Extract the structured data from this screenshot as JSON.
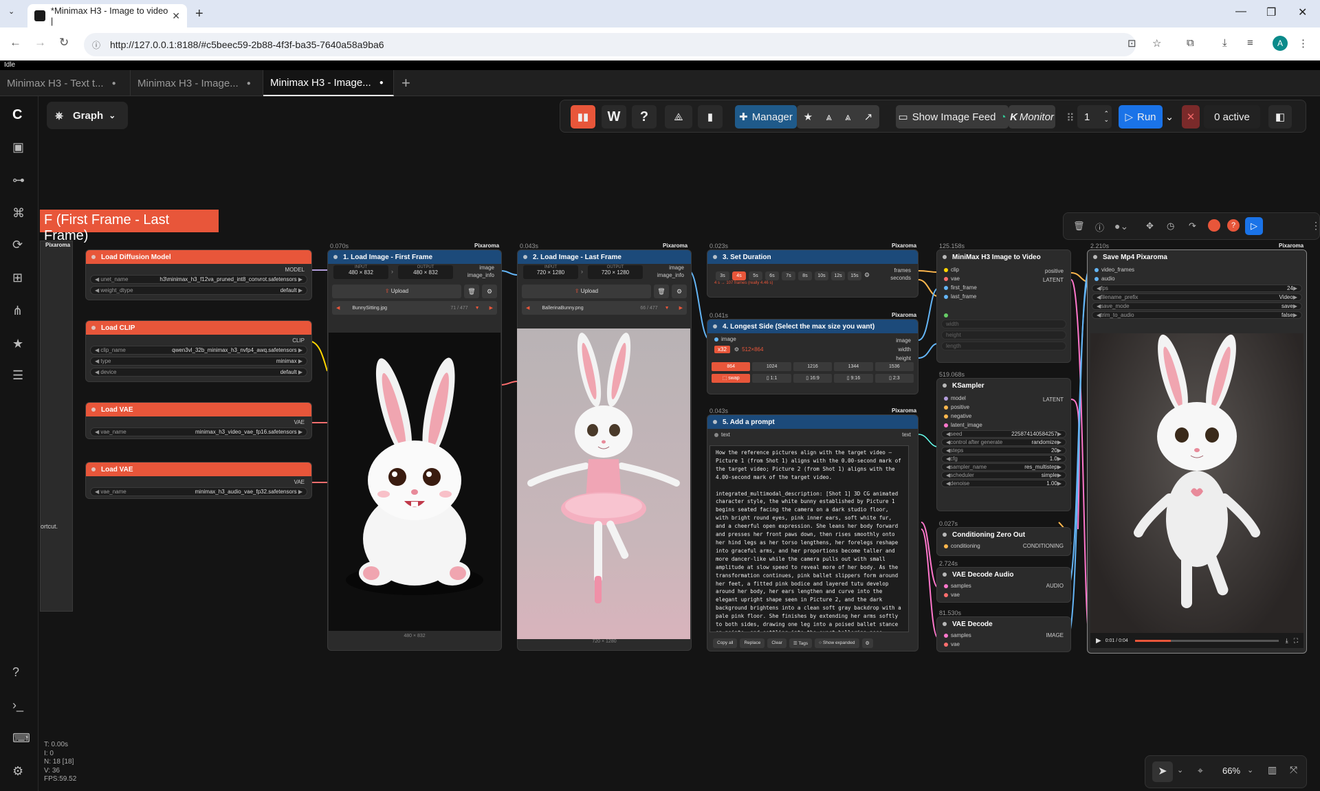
{
  "browser": {
    "tab_title": "*Minimax H3 - Image to video |",
    "url": "http://127.0.0.1:8188/#c5beec59-2b88-4f3f-ba35-7640a58a9ba6",
    "avatar_letter": "A"
  },
  "status_bar": "Idle",
  "workflow_tabs": [
    "Minimax H3 - Text t...",
    "Minimax H3 - Image...",
    "Minimax H3 - Image..."
  ],
  "graph_label": "Graph",
  "toolbar": {
    "w_label": "W",
    "help_label": "?",
    "manager": "Manager",
    "show_image_feed": "Show Image Feed",
    "monitor": "Monitor",
    "queue_count": "1",
    "run": "Run",
    "active": "0 active"
  },
  "group_title": "F (First Frame - Last Frame)",
  "nodes": {
    "load_diffusion": {
      "title": "Load Diffusion Model",
      "output": "MODEL",
      "unet_name": "h3\\minimax_h3_f12va_pruned_int8_convrot.safetensors",
      "weight_dtype": "default"
    },
    "load_clip": {
      "title": "Load CLIP",
      "output": "CLIP",
      "clip_name": "qwen3vl_32b_minimax_h3_nvfp4_awq.safetensors",
      "type": "minimax",
      "device": "default"
    },
    "load_vae_1": {
      "title": "Load VAE",
      "output": "VAE",
      "vae_name": "minimax_h3_video_vae_fp16.safetensors"
    },
    "load_vae_2": {
      "title": "Load VAE",
      "output": "VAE",
      "vae_name": "minimax_h3_audio_vae_fp32.safetensors"
    },
    "image1": {
      "time": "0.070s",
      "title": "1. Load Image - First Frame",
      "input_lbl": "INPUT",
      "input": "480 × 832",
      "output_lbl": "OUTPUT",
      "output": "480 × 832",
      "file": "BunnySitting.jpg",
      "counter": "71 / 477",
      "footer": "480 × 832",
      "upload": "Upload",
      "out1": "image",
      "out2": "image_info"
    },
    "image2": {
      "time": "0.043s",
      "title": "2. Load Image - Last Frame",
      "input_lbl": "INPUT",
      "input": "720 × 1280",
      "output_lbl": "OUTPUT",
      "output": "720 × 1280",
      "file": "BallerinaBunny.png",
      "counter": "66 / 477",
      "footer": "720 × 1280",
      "upload": "Upload",
      "out1": "image",
      "out2": "image_info"
    },
    "duration": {
      "time": "0.023s",
      "title": "3. Set Duration",
      "options": [
        "3s",
        "4s",
        "5s",
        "6s",
        "7s",
        "8s",
        "10s",
        "12s",
        "15s"
      ],
      "selected": "4s",
      "note": "4 s → 107 frames (really 4.46 s)",
      "out1": "frames",
      "out2": "seconds"
    },
    "longest": {
      "time": "0.041s",
      "title": "4. Longest Side (Select the max size you want)",
      "input": "image",
      "x32": "x32",
      "size": "512×864",
      "sizes": [
        "864",
        "1024",
        "1216",
        "1344",
        "1536"
      ],
      "swap": "swap",
      "ratios": [
        "1:1",
        "16:9",
        "9:16",
        "2:3"
      ],
      "outs": [
        "image",
        "width",
        "height"
      ]
    },
    "prompt": {
      "time": "0.043s",
      "title": "5. Add a prompt",
      "in": "text",
      "out": "text",
      "text": "How the reference pictures align with the target video — Picture 1 (from Shot 1) aligns with the 0.00-second mark of the target video; Picture 2 (from Shot 1) aligns with the 4.00-second mark of the target video.\n\nintegrated_multimodal_description: [Shot 1] 3D CG animated character style, the white bunny established by Picture 1 begins seated facing the camera on a dark studio floor, with bright round eyes, pink inner ears, soft white fur, and a cheerful open expression. She leans her body forward and presses her front paws down, then rises smoothly onto her hind legs as her torso lengthens, her forelegs reshape into graceful arms, and her proportions become taller and more dancer-like while the camera pulls out with small amplitude at slow speed to reveal more of her body. As the transformation continues, pink ballet slippers form around her feet, a fitted pink bodice and layered tutu develop around her body, her ears lengthen and curve into the elegant upright shape seen in Picture 2, and the dark background brightens into a clean soft gray backdrop with a pale pink floor. She finishes by extending her arms softly to both sides, drawing one leg into a poised ballet stance on pointe, and settling into the exact ballerina pose, proportions, lighting, viewpoint, and full-",
      "buttons": [
        "Copy all",
        "Replace",
        "Clear",
        "Tags",
        "Show expanded"
      ]
    },
    "minimax": {
      "time": "125.158s",
      "title": "MiniMax H3 Image to Video",
      "inputs": [
        "clip",
        "vae",
        "first_frame",
        "last_frame"
      ],
      "outputs": [
        "positive",
        "LATENT"
      ],
      "widgets": [
        "width",
        "height",
        "length"
      ]
    },
    "ksampler": {
      "time": "519.068s",
      "title": "KSampler",
      "inputs": [
        "model",
        "positive",
        "negative",
        "latent_image"
      ],
      "output": "LATENT",
      "widgets": [
        [
          "seed",
          "225874140584257"
        ],
        [
          "control after generate",
          "randomize"
        ],
        [
          "steps",
          "20"
        ],
        [
          "cfg",
          "1.0"
        ],
        [
          "sampler_name",
          "res_multistep"
        ],
        [
          "scheduler",
          "simple"
        ],
        [
          "denoise",
          "1.00"
        ]
      ]
    },
    "cond_zero": {
      "time": "0.027s",
      "title": "Conditioning Zero Out",
      "input": "conditioning",
      "output": "CONDITIONING"
    },
    "vae_audio": {
      "time": "2.724s",
      "title": "VAE Decode Audio",
      "inputs": [
        "samples",
        "vae"
      ],
      "output": "AUDIO"
    },
    "vae_decode": {
      "time": "81.530s",
      "title": "VAE Decode",
      "inputs": [
        "samples",
        "vae"
      ],
      "output": "IMAGE"
    },
    "save": {
      "time": "2.210s",
      "title": "Save Mp4 Pixaroma",
      "inputs": [
        "video_frames",
        "audio"
      ],
      "widgets": [
        [
          "fps",
          "24"
        ],
        [
          "filename_prefix",
          "Video"
        ],
        [
          "save_mode",
          "save"
        ],
        [
          "trim_to_audio",
          "false"
        ]
      ],
      "player_time": "0:01 / 0:04"
    }
  },
  "brand": "Pixaroma",
  "left_partial": "ortcut.",
  "stats": {
    "t": "T: 0.00s",
    "i": "I: 0",
    "n": "N: 18 [18]",
    "v": "V: 36",
    "fps": "FPS:59.52"
  },
  "zoom": "66%",
  "colors": {
    "accent_red": "#e8563a",
    "accent_blue": "#1a73e8",
    "node_blue": "#1c4a7a"
  }
}
